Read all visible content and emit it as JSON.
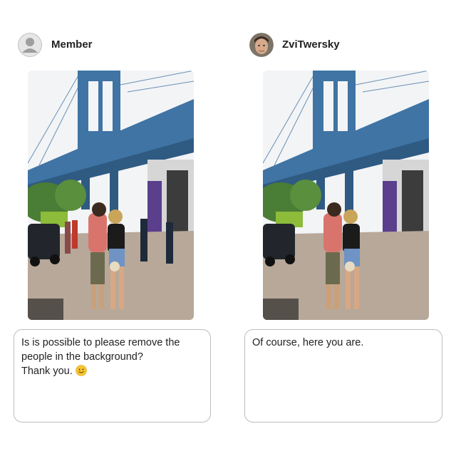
{
  "left": {
    "username": "Member",
    "avatar_icon": "default-user-avatar-icon",
    "message_lines": [
      "Is is possible to please remove the",
      "people in the background?",
      "Thank you."
    ],
    "emoji": "slightly-smiling-face-emoji"
  },
  "right": {
    "username": "ZviTwersky",
    "avatar_icon": "user-photo-avatar",
    "message": "Of course, here you are."
  },
  "colors": {
    "bridge": "#3f74a4",
    "sky": "#f2f4f6",
    "truck_panel": "#5b3f8c",
    "bubble_border": "#bdbdbd"
  }
}
